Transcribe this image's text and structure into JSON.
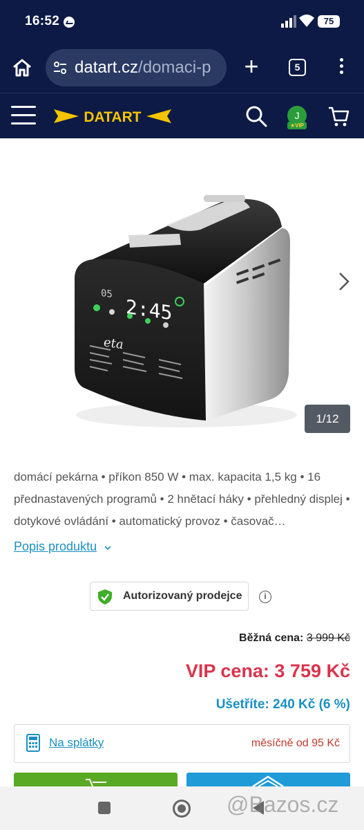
{
  "status_bar": {
    "time": "16:52",
    "battery": "75",
    "icons": [
      "messenger-icon",
      "signal-icon",
      "wifi-icon",
      "battery-icon"
    ]
  },
  "browser": {
    "url_domain": "datart.cz",
    "url_path": "/domaci-p",
    "tab_count": "5",
    "icons": [
      "home-icon",
      "site-settings-icon",
      "plus-icon",
      "tabs-icon",
      "menu-dots-icon"
    ]
  },
  "site_header": {
    "logo_text": "DATART",
    "user_initial": "J",
    "vip_label": "VIP",
    "icons": [
      "hamburger-icon",
      "search-icon",
      "cart-icon"
    ]
  },
  "gallery": {
    "counter": "1/12",
    "image_alt": "product-photo-bread-maker",
    "brand_print": "eta"
  },
  "product": {
    "description": "domácí pekárna • příkon 850 W • max. kapacita 1,5 kg • 16 přednastavených programů • 2 hnětací háky • přehledný displej • dotykové ovládání • automatický provoz • časovač…",
    "description_link": "Popis produktu",
    "authorized_seller": "Autorizovaný prodejce"
  },
  "pricing": {
    "regular_label": "Běžná cena:",
    "regular_value": "3 999 Kč",
    "vip_price": "VIP cena: 3 759 Kč",
    "savings": "Ušetříte: 240 Kč (6 %)"
  },
  "installments": {
    "link": "Na splátky",
    "monthly": "měsíčně od 95 Kč"
  },
  "watermark": "@Bazos.cz",
  "colors": {
    "navy": "#0c1a45",
    "logo_yellow": "#f5c400",
    "vip_red": "#d9344c",
    "link_blue": "#1a8fc4",
    "cart_green": "#5aa924",
    "compare_blue": "#1f9bd7"
  }
}
